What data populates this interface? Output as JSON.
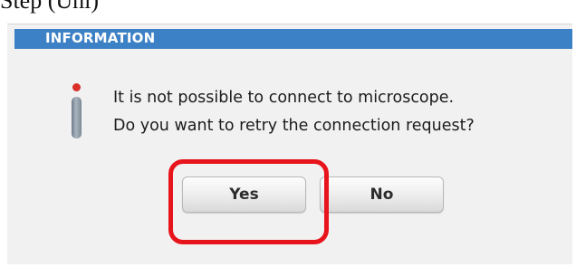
{
  "caption": "Step (Uni)",
  "dialog": {
    "title": "INFORMATION",
    "message_line1": "It is not possible to connect to microscope.",
    "message_line2": "Do you want to retry the connection request?",
    "buttons": {
      "yes_label": "Yes",
      "no_label": "No"
    },
    "icon": "info-icon"
  },
  "colors": {
    "titlebar": "#3c80c5",
    "dialog_background": "#f1f1f1",
    "highlight": "#e8141b",
    "icon_dot": "#d9302a"
  }
}
